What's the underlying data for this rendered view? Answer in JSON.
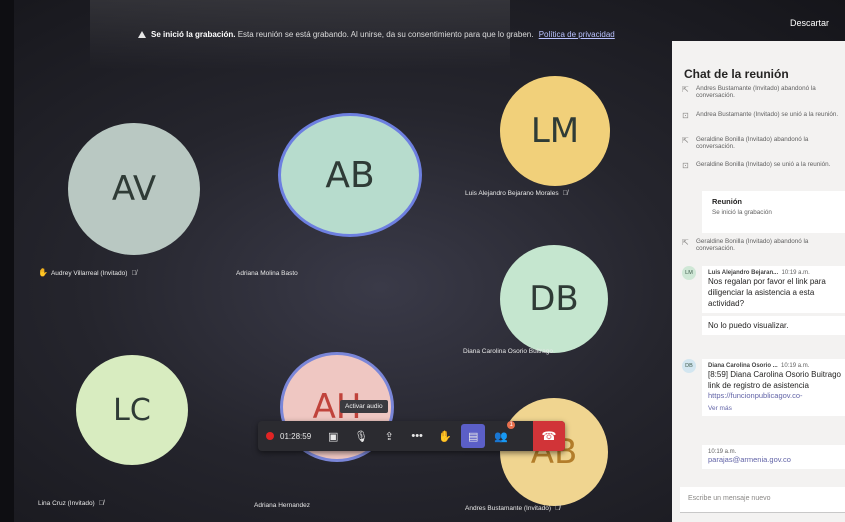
{
  "banner": {
    "title": "Se inició la grabación.",
    "text": "Esta reunión se está grabando. Al unirse, da su consentimiento para que lo graben.",
    "policy_link": "Política de privacidad"
  },
  "dismiss_label": "Descartar",
  "participants": [
    {
      "initials": "AV",
      "name": "Audrey Villarreal (Invitado)",
      "color": "#b9c8c2",
      "hand": "raised-hand-icon"
    },
    {
      "initials": "AB",
      "name": "Adriana Molina Basto",
      "color": "#b7dccd"
    },
    {
      "initials": "LM",
      "name": "Luis Alejandro Bejarano Morales",
      "color": "#f1d07a"
    },
    {
      "initials": "DB",
      "name": "Diana Carolina Osorio Buitrago",
      "color": "#c5e6cf"
    },
    {
      "initials": "LC",
      "name": "Lina Cruz (Invitado)",
      "color": "#d8ecc0"
    },
    {
      "initials": "AH",
      "name": "Adriana Hernandez",
      "color": "#efc7c2"
    },
    {
      "initials": "AB",
      "name": "Andres Bustamante (Invitado)",
      "color": "#f0d590"
    }
  ],
  "controls": {
    "timer": "01:28:59",
    "tooltip": "Activar audio",
    "badge_count": "1"
  },
  "chat": {
    "title": "Chat de la reunión",
    "events": [
      {
        "text": "Andres Bustamante (Invitado) abandonó la conversación."
      },
      {
        "text": "Andrea Bustamante (Invitado) se unió a la reunión."
      },
      {
        "text": "Geraldine Bonilla (Invitado) abandonó la conversación."
      },
      {
        "text": "Geraldine Bonilla (Invitado) se unió a la reunión."
      }
    ],
    "meeting_card": {
      "title": "Reunión",
      "subtitle": "Se inició la grabación"
    },
    "event_after": "Geraldine Bonilla (Invitado) abandonó la conversación.",
    "messages": [
      {
        "initials": "LM",
        "avatar_color": "#cfe7d6",
        "author": "Luis Alejandro Bejaran...",
        "time": "10:19 a.m.",
        "text": "Nos regalan por favor el link para diligenciar la asistencia a esta actividad?",
        "followup": "No lo puedo visualizar."
      },
      {
        "initials": "DB",
        "avatar_color": "#d3e6f0",
        "author": "Diana Carolina Osorio ...",
        "time": "10:19 a.m.",
        "text": "[8:59] Diana Carolina Osorio Buitrago",
        "text2": "link de registro de asistencia",
        "link": "https://funcionpublicagov.co-",
        "see_more": "Ver más"
      },
      {
        "time": "10:19 a.m.",
        "text": "parajas@armenia.gov.co"
      }
    ],
    "compose_placeholder": "Escribe un mensaje nuevo"
  }
}
